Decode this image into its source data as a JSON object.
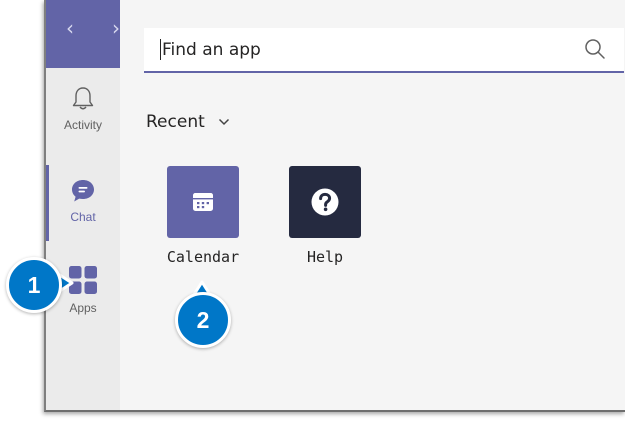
{
  "colors": {
    "brand": "#6264a7",
    "rail_bg": "#ebebeb",
    "panel_bg": "#f5f5f5",
    "help_tile": "#252a40",
    "badge": "#0077c8"
  },
  "rail": {
    "items": [
      {
        "label": "Activity",
        "icon": "bell-icon"
      },
      {
        "label": "Chat",
        "icon": "chat-icon",
        "active": true
      },
      {
        "label": "Apps",
        "icon": "apps-grid-icon"
      }
    ]
  },
  "search": {
    "placeholder": "Find an app",
    "icon": "search-icon"
  },
  "section": {
    "label": "Recent",
    "icon": "chevron-down-icon"
  },
  "apps": [
    {
      "label": "Calendar",
      "icon": "calendar-icon"
    },
    {
      "label": "Help",
      "icon": "help-icon"
    }
  ],
  "callouts": [
    {
      "number": "1"
    },
    {
      "number": "2"
    }
  ]
}
